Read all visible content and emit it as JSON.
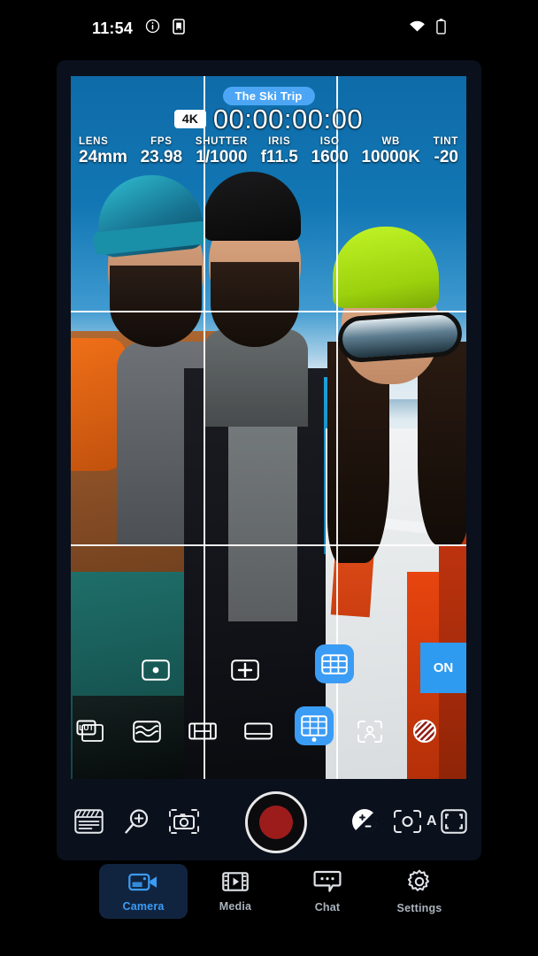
{
  "status_bar": {
    "time": "11:54",
    "icons": [
      "info-icon",
      "phone-download-icon",
      "wifi-icon",
      "battery-icon"
    ]
  },
  "viewfinder": {
    "project_badge": "The Ski Trip",
    "resolution_badge": "4K",
    "timecode": "00:00:00:00",
    "grid_overlay": true,
    "metering": [
      {
        "label": "LENS",
        "value": "24mm"
      },
      {
        "label": "FPS",
        "value": "23.98"
      },
      {
        "label": "SHUTTER",
        "value": "1/1000"
      },
      {
        "label": "IRIS",
        "value": "f11.5"
      },
      {
        "label": "ISO",
        "value": "1600"
      },
      {
        "label": "WB",
        "value": "10000K"
      },
      {
        "label": "TINT",
        "value": "-20"
      }
    ]
  },
  "overlay_tools": {
    "toggle_label": "ON",
    "top_row": [
      {
        "name": "center-dot-icon",
        "active": false
      },
      {
        "name": "center-cross-icon",
        "active": false
      },
      {
        "name": "grid-guides-icon",
        "active": true
      }
    ],
    "bottom_row": [
      {
        "name": "lut-icon",
        "active": false
      },
      {
        "name": "waveform-icon",
        "active": false
      },
      {
        "name": "frame-guide-icon",
        "active": false
      },
      {
        "name": "letterbox-icon",
        "active": false
      },
      {
        "name": "grid-overlay-icon",
        "active": true
      },
      {
        "name": "face-detect-icon",
        "active": false
      },
      {
        "name": "zebra-stripes-icon",
        "active": false
      }
    ]
  },
  "camera_controls": {
    "left": [
      "slate-icon",
      "zoom-in-icon",
      "camera-framing-icon"
    ],
    "record_button": "record-button",
    "right": [
      "exposure-compensation-icon",
      "autofocus-icon",
      "expand-icon"
    ],
    "autofocus_mode": "A"
  },
  "bottom_nav": {
    "items": [
      {
        "label": "Camera",
        "icon": "video-camera-icon",
        "active": true
      },
      {
        "label": "Media",
        "icon": "film-play-icon",
        "active": false
      },
      {
        "label": "Chat",
        "icon": "chat-bubble-icon",
        "active": false
      },
      {
        "label": "Settings",
        "icon": "gear-icon",
        "active": false
      }
    ]
  },
  "colors": {
    "accent": "#3b9cf5",
    "pill": "#4ca6f5",
    "panel": "#0a101c",
    "nav_active_bg": "#11243f",
    "record_inner": "#9c1c1c",
    "background": "#000000"
  }
}
